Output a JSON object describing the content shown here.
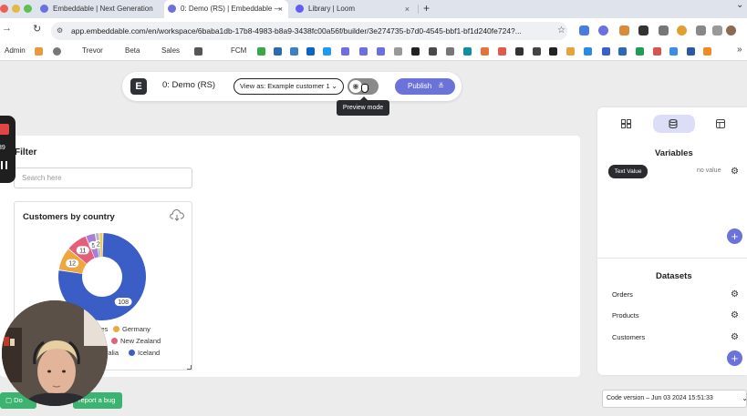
{
  "browser": {
    "tabs": [
      {
        "label": "Embeddable | Next Generation",
        "active": false
      },
      {
        "label": "0: Demo (RS) | Embeddable —",
        "active": true
      },
      {
        "label": "Library | Loom",
        "active": false
      }
    ],
    "new_tab": "+",
    "menu_chevron": "⌄",
    "url": "app.embeddable.com/en/workspace/6baba1db-17b8-4983-b8a9-3438fc00a56f/builder/3e274735-b7d0-4545-bbf1-bf1d240fe724?...",
    "bookmarks": [
      "Admin",
      "Trevor",
      "Beta",
      "Sales",
      "FCM"
    ],
    "bookmarks_overflow": "»"
  },
  "toolbar": {
    "logo_letter": "E",
    "workspace_title": "0: Demo (RS)",
    "view_as_label": "View as: Example customer 1",
    "view_as_chevron": "⌄",
    "publish_label": "Publish",
    "preview_tooltip": "Preview mode"
  },
  "canvas": {
    "filter_title": "Filter",
    "search_placeholder": "Search here",
    "chart_title": "Customers by country"
  },
  "chart_data": {
    "type": "pie",
    "title": "Customers by country",
    "values": [
      108,
      12,
      11,
      5,
      2,
      2
    ],
    "data_labels": [
      "108",
      "12",
      "11",
      "5",
      "2",
      ""
    ],
    "legend_visible": [
      "res",
      "Germany",
      "New Zealand",
      "stralia",
      "Iceland"
    ],
    "colors": [
      "#3b5ec6",
      "#f0a640",
      "#e4607a",
      "#a87fd6",
      "#b2b8c6",
      "#eecb55"
    ],
    "legend_colors": {
      "Germany": "#f0a640",
      "New Zealand": "#e4607a",
      "Iceland": "#3b5ec6"
    }
  },
  "sidebar": {
    "variables_title": "Variables",
    "variable_chip": "Text Value",
    "variable_value": "no value",
    "datasets_title": "Datasets",
    "datasets": [
      "Orders",
      "Products",
      "Customers"
    ],
    "add_symbol": "+"
  },
  "footer": {
    "code_version": "Code version – Jun 03 2024 15:51:33",
    "btn_left": "Do",
    "btn_right": "report a bug"
  },
  "recorder": {
    "timer": "39"
  }
}
